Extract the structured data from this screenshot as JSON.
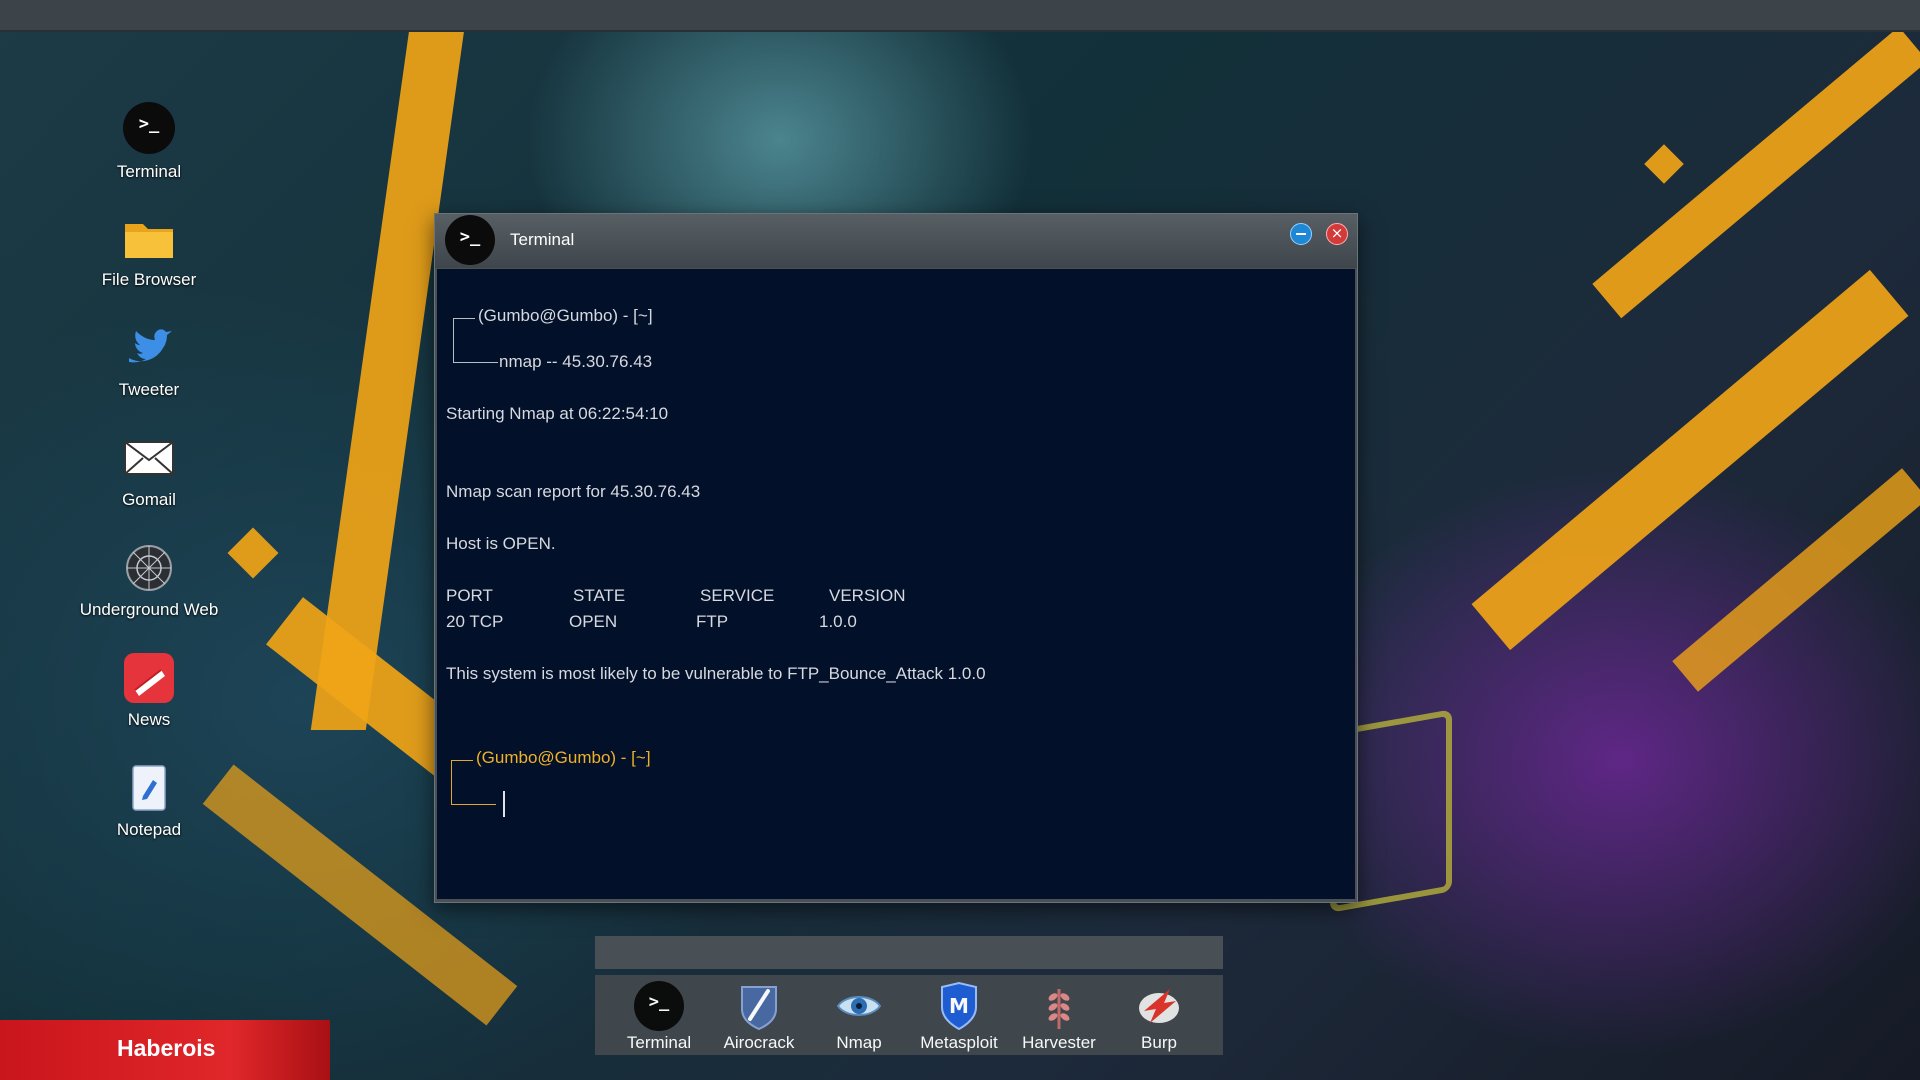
{
  "desktop_icons": [
    {
      "label": "Terminal",
      "icon": "terminal-icon"
    },
    {
      "label": "File Browser",
      "icon": "folder-icon"
    },
    {
      "label": "Tweeter",
      "icon": "bird-icon"
    },
    {
      "label": "Gomail",
      "icon": "envelope-icon"
    },
    {
      "label": "Underground Web",
      "icon": "web-icon"
    },
    {
      "label": "News",
      "icon": "news-icon"
    },
    {
      "label": "Notepad",
      "icon": "notepad-icon"
    }
  ],
  "terminal": {
    "title": "Terminal",
    "prompt1": "(Gumbo@Gumbo) - [~]",
    "command1": "nmap -- 45.30.76.43",
    "line_start": "Starting Nmap at 06:22:54:10",
    "line_report": "Nmap scan report for 45.30.76.43",
    "line_host": "Host is OPEN.",
    "table_headers": [
      "PORT",
      "STATE",
      "SERVICE",
      "VERSION"
    ],
    "table_row": [
      "20 TCP",
      "OPEN",
      "FTP",
      "1.0.0"
    ],
    "line_vuln": "This system is most likely to be vulnerable to FTP_Bounce_Attack 1.0.0",
    "prompt2": "(Gumbo@Gumbo) - [~]"
  },
  "dock": [
    {
      "label": "Terminal",
      "icon": "terminal-icon"
    },
    {
      "label": "Airocrack",
      "icon": "feather-shield-icon"
    },
    {
      "label": "Nmap",
      "icon": "eye-icon"
    },
    {
      "label": "Metasploit",
      "icon": "m-shield-icon"
    },
    {
      "label": "Harvester",
      "icon": "wheat-icon"
    },
    {
      "label": "Burp",
      "icon": "burp-icon"
    }
  ],
  "user": {
    "name": "Haberois"
  },
  "colors": {
    "accent_amber": "#f1b126",
    "terminal_bg": "#02102a",
    "badge_red": "#e0272a"
  }
}
